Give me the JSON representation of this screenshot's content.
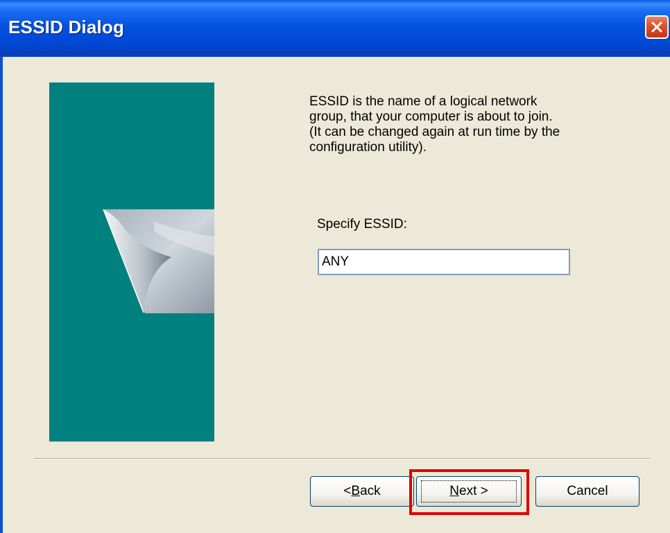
{
  "window": {
    "title": "ESSID Dialog"
  },
  "content": {
    "description": "ESSID is the name of a logical network\ngroup, that your computer is about to join.\n(It can be changed again at run time by the\nconfiguration utility).",
    "essid_label": "Specify ESSID:",
    "essid_value": "ANY"
  },
  "buttons": {
    "back_prefix": "< ",
    "back_mnemonic": "B",
    "back_rest": "ack",
    "next_mnemonic": "N",
    "next_rest": "ext >",
    "cancel": "Cancel"
  },
  "icons": {
    "close": "close-icon",
    "banner": "page-curl-graphic"
  },
  "colors": {
    "titlebar": "#0553df",
    "dialog_bg": "#ece9d8",
    "banner_bg": "#00807f",
    "highlight": "#e00000",
    "close_button": "#e2542b"
  }
}
